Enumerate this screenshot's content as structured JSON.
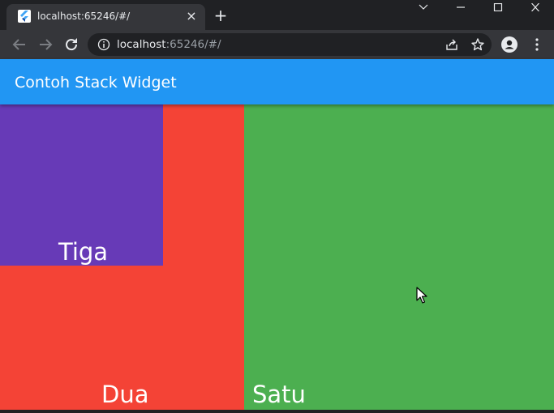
{
  "browser": {
    "tab_title": "localhost:65246/#/",
    "tab_close": "×",
    "new_tab": "+",
    "url_host": "localhost",
    "url_rest": ":65246/#/"
  },
  "app": {
    "title": "Contoh Stack Widget"
  },
  "stack": {
    "satu": {
      "label": "Satu",
      "color": "#4caf50"
    },
    "dua": {
      "label": "Dua",
      "color": "#f44336"
    },
    "tiga": {
      "label": "Tiga",
      "color": "#673ab7"
    }
  },
  "icons": {
    "favicon": "flutter-icon",
    "back": "arrow-left-icon",
    "forward": "arrow-right-icon",
    "reload": "reload-icon",
    "info": "info-icon",
    "share": "share-icon",
    "bookmark": "star-icon",
    "profile": "profile-icon",
    "menu": "kebab-menu-icon"
  }
}
